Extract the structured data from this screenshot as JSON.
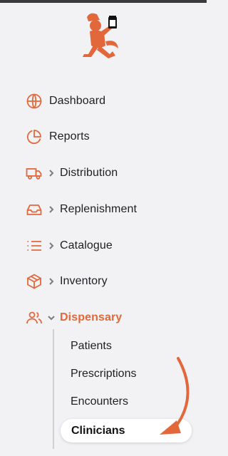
{
  "brand": {
    "name": "",
    "accent": "#e2683c"
  },
  "nav": {
    "items": [
      {
        "label": "Dashboard",
        "icon": "globe-icon"
      },
      {
        "label": "Reports",
        "icon": "pie-chart-icon"
      },
      {
        "label": "Distribution",
        "icon": "truck-icon",
        "expandable": true
      },
      {
        "label": "Replenishment",
        "icon": "inbox-icon",
        "expandable": true
      },
      {
        "label": "Catalogue",
        "icon": "list-icon",
        "expandable": true
      },
      {
        "label": "Inventory",
        "icon": "box-icon",
        "expandable": true
      },
      {
        "label": "Dispensary",
        "icon": "users-icon",
        "expandable": true,
        "expanded": true,
        "active": true
      }
    ],
    "dispensary_sub": [
      {
        "label": "Patients"
      },
      {
        "label": "Prescriptions"
      },
      {
        "label": "Encounters"
      },
      {
        "label": "Clinicians",
        "selected": true
      }
    ]
  }
}
